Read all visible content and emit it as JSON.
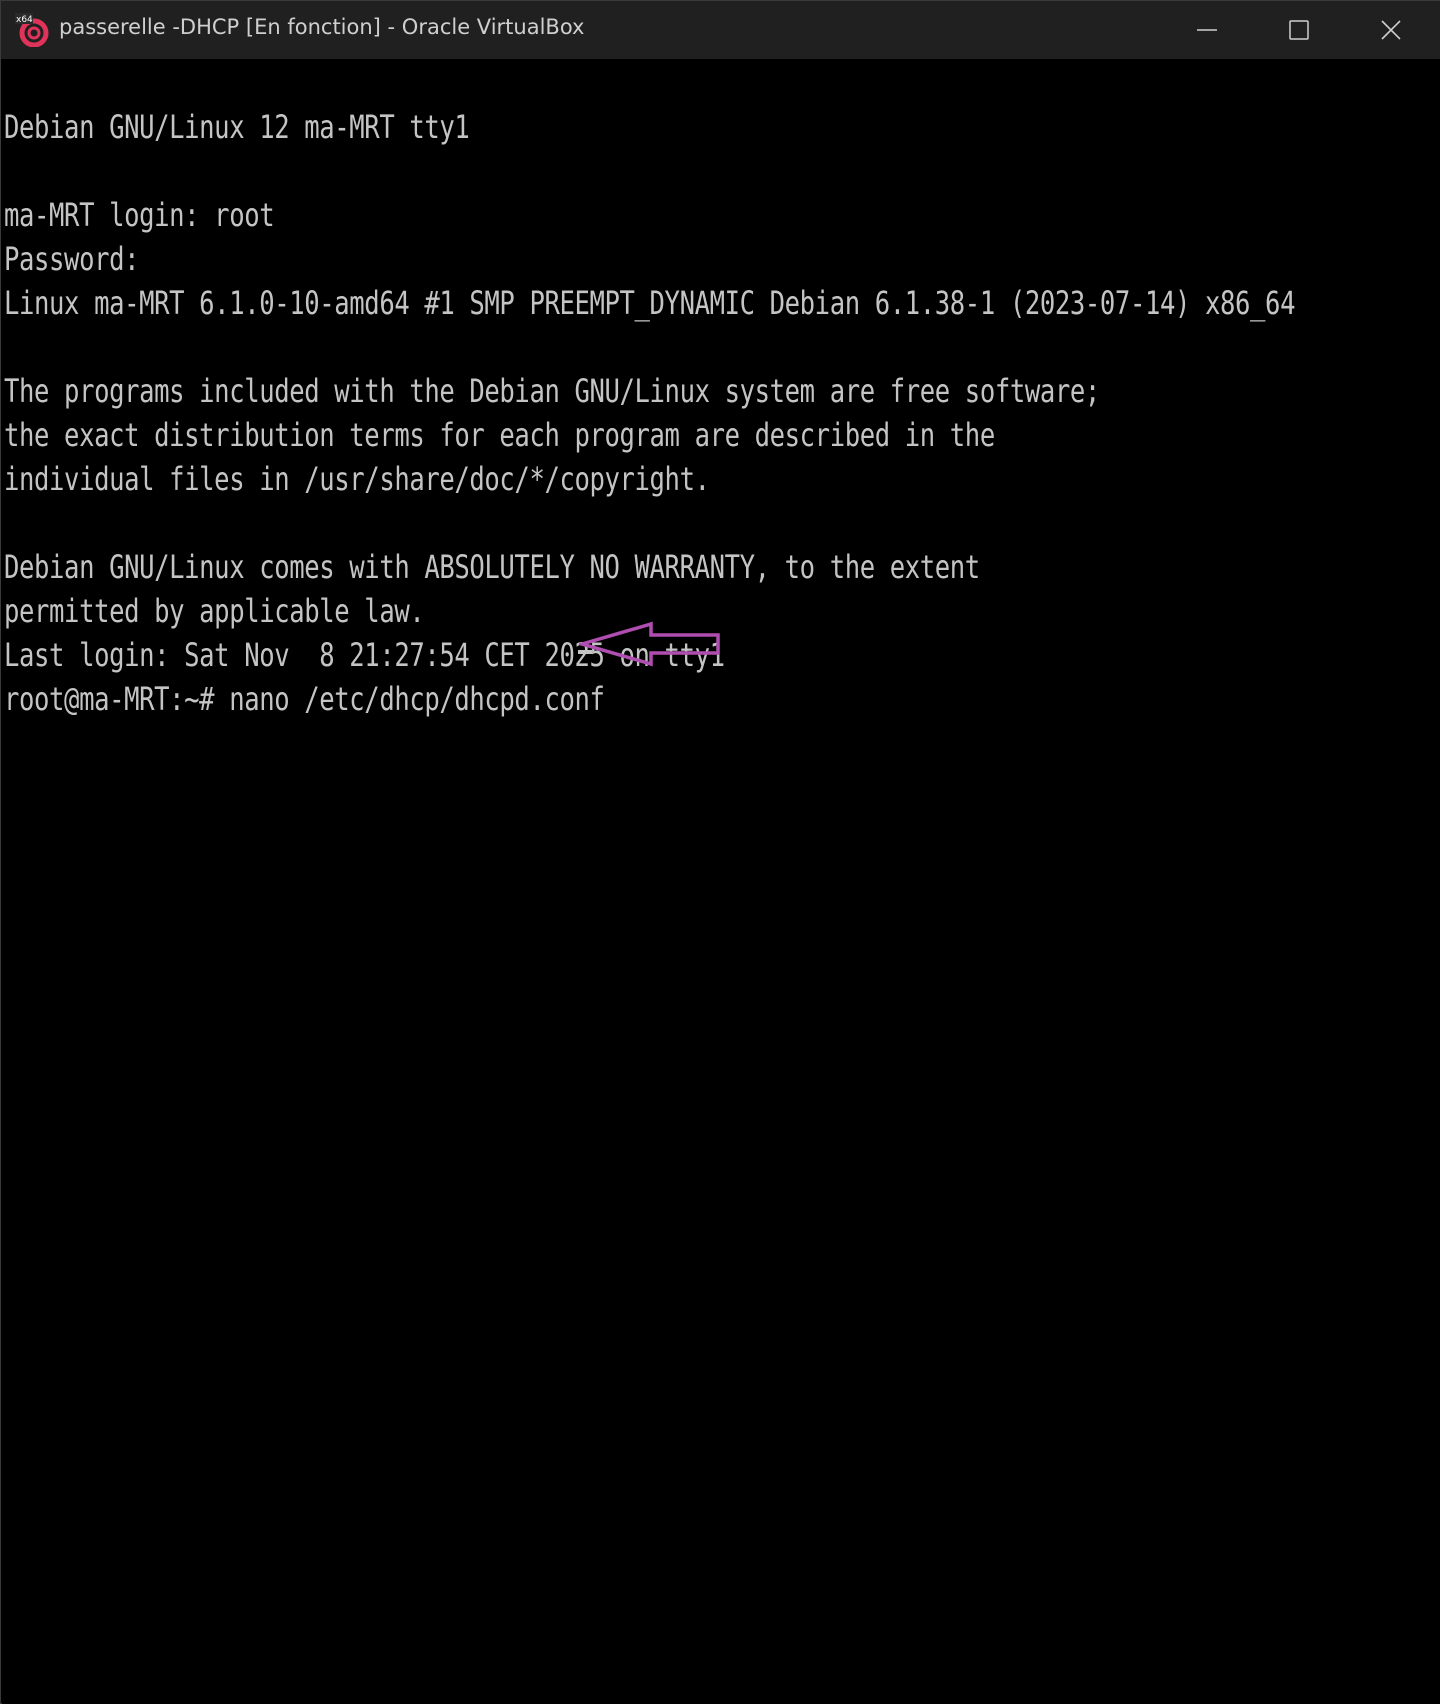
{
  "window": {
    "title": "passerelle -DHCP [En fonction] - Oracle VirtualBox",
    "app_icon": "virtualbox-icon",
    "app_icon_badge": "x64",
    "controls": [
      "minimize-icon",
      "maximize-icon",
      "close-icon"
    ]
  },
  "terminal": {
    "lines": [
      "Debian GNU/Linux 12 ma-MRT tty1",
      "",
      "ma-MRT login: root",
      "Password:",
      "Linux ma-MRT 6.1.0-10-amd64 #1 SMP PREEMPT_DYNAMIC Debian 6.1.38-1 (2023-07-14) x86_64",
      "",
      "The programs included with the Debian GNU/Linux system are free software;",
      "the exact distribution terms for each program are described in the",
      "individual files in /usr/share/doc/*/copyright.",
      "",
      "Debian GNU/Linux comes with ABSOLUTELY NO WARRANTY, to the extent",
      "permitted by applicable law.",
      "Last login: Sat Nov  8 21:27:54 CET 2025 on tty1",
      "root@ma-MRT:~# nano /etc/dhcp/dhcpd.conf"
    ],
    "text_color": "#c4c4c4",
    "background": "#000000"
  },
  "annotation": {
    "icon": "arrow-left-icon",
    "color": "#b04db0"
  }
}
